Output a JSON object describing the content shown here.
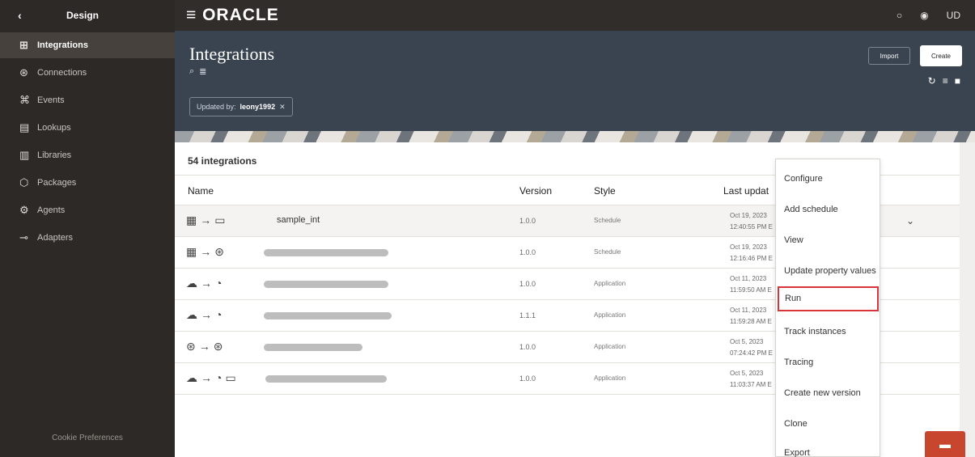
{
  "sidebar": {
    "back_icon": "chevron-left-icon",
    "title": "Design",
    "items": [
      {
        "label": "Integrations",
        "icon": "integrations-icon"
      },
      {
        "label": "Connections",
        "icon": "connections-icon"
      },
      {
        "label": "Events",
        "icon": "events-icon"
      },
      {
        "label": "Lookups",
        "icon": "lookups-icon"
      },
      {
        "label": "Libraries",
        "icon": "libraries-icon"
      },
      {
        "label": "Packages",
        "icon": "packages-icon"
      },
      {
        "label": "Agents",
        "icon": "agents-icon"
      },
      {
        "label": "Adapters",
        "icon": "adapters-icon"
      }
    ],
    "footer": "Cookie Preferences"
  },
  "header": {
    "logo": "≡ ORACLE",
    "user_initials": "UD",
    "page_title": "Integrations",
    "filter_prefix": "Updated by:",
    "filter_value": "leony1992",
    "import_label": "Import",
    "create_label": "Create"
  },
  "table": {
    "count_label": "54 integrations",
    "headers": [
      "Name",
      "Version",
      "Style",
      "Last updat"
    ],
    "rows": [
      {
        "from": "calendar-icon",
        "to": "folder-icon",
        "name": "sample_int",
        "version": "1.0.0",
        "style": "Schedule",
        "date1": "Oct 19, 2023",
        "date2": "12:40:55 PM E"
      },
      {
        "from": "calendar-icon",
        "to": "connection-icon",
        "name": "",
        "version": "1.0.0",
        "style": "Schedule",
        "date1": "Oct 19, 2023",
        "date2": "12:16:46 PM E"
      },
      {
        "from": "cloud-icon",
        "to": "webhook-icon",
        "name": "",
        "version": "1.0.0",
        "style": "Application",
        "date1": "Oct 11, 2023",
        "date2": "11:59:50 AM E"
      },
      {
        "from": "cloud-icon",
        "to": "webhook-icon",
        "name": "",
        "version": "1.1.1",
        "style": "Application",
        "date1": "Oct 11, 2023",
        "date2": "11:59:28 AM E"
      },
      {
        "from": "connection-icon",
        "to": "connection-icon",
        "name": "",
        "version": "1.0.0",
        "style": "Application",
        "date1": "Oct 5, 2023",
        "date2": "07:24:42 PM E"
      },
      {
        "from": "cloud-icon",
        "to": "webhook-icon",
        "name": "",
        "version": "1.0.0",
        "style": "Application",
        "date1": "Oct 5, 2023",
        "date2": "11:03:37 AM E"
      }
    ]
  },
  "menu": {
    "items": [
      "Configure",
      "Add schedule",
      "View",
      "Update property values",
      "Run",
      "Track instances",
      "Tracing",
      "Create new version",
      "Clone",
      "Export"
    ]
  },
  "colors": {
    "sidebar_bg": "#2c2926",
    "header_bg": "#3a4450",
    "highlight_border": "#d9343a",
    "chat_button": "#c8452e"
  }
}
